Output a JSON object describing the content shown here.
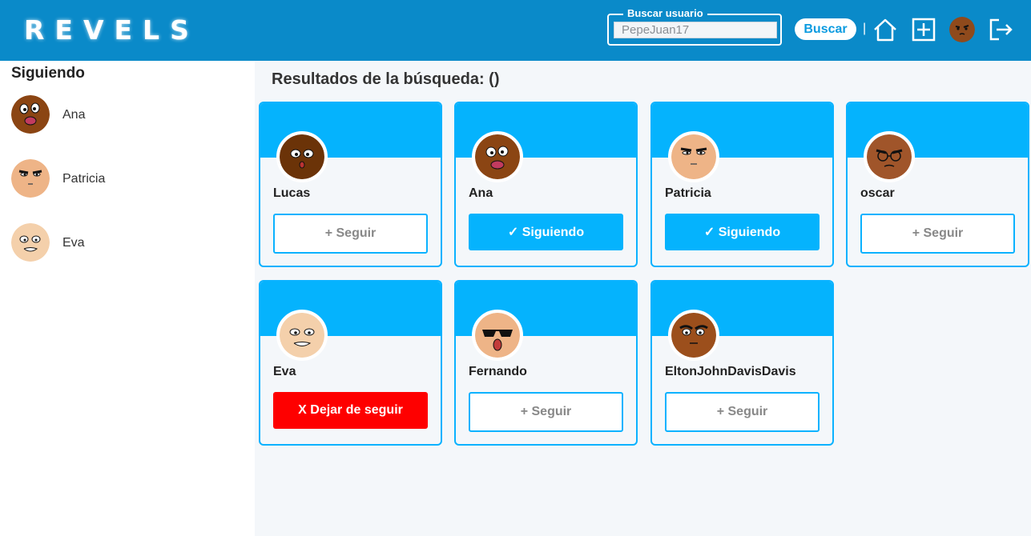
{
  "header": {
    "logo": "REVELS",
    "search_legend": "Buscar usuario",
    "search_value": "PepeJuan17",
    "search_button": "Buscar",
    "separator": "|",
    "icons": [
      "home-icon",
      "add-square-icon",
      "user-avatar",
      "logout-icon"
    ]
  },
  "sidebar": {
    "title": "Siguiendo",
    "items": [
      {
        "name": "Ana",
        "avatar": "ana"
      },
      {
        "name": "Patricia",
        "avatar": "patricia"
      },
      {
        "name": "Eva",
        "avatar": "eva"
      }
    ]
  },
  "results": {
    "title": "Resultados de la búsqueda: ()",
    "cards": [
      {
        "name": "Lucas",
        "button": "+ Seguir",
        "state": "follow",
        "avatar": "lucas"
      },
      {
        "name": "Ana",
        "button": "✓ Siguiendo",
        "state": "following",
        "avatar": "ana"
      },
      {
        "name": "Patricia",
        "button": "✓ Siguiendo",
        "state": "following",
        "avatar": "patricia"
      },
      {
        "name": "oscar",
        "button": "+ Seguir",
        "state": "follow",
        "avatar": "oscar"
      },
      {
        "name": "Eva",
        "button": "X Dejar de seguir",
        "state": "unfollow",
        "avatar": "eva"
      },
      {
        "name": "Fernando",
        "button": "+ Seguir",
        "state": "follow",
        "avatar": "fernando"
      },
      {
        "name": "EltonJohnDavisDavis",
        "button": "+ Seguir",
        "state": "follow",
        "avatar": "elton"
      }
    ]
  },
  "colors": {
    "header": "#0a8ac9",
    "accent": "#05b3fd",
    "unfollow": "#fe0000"
  }
}
